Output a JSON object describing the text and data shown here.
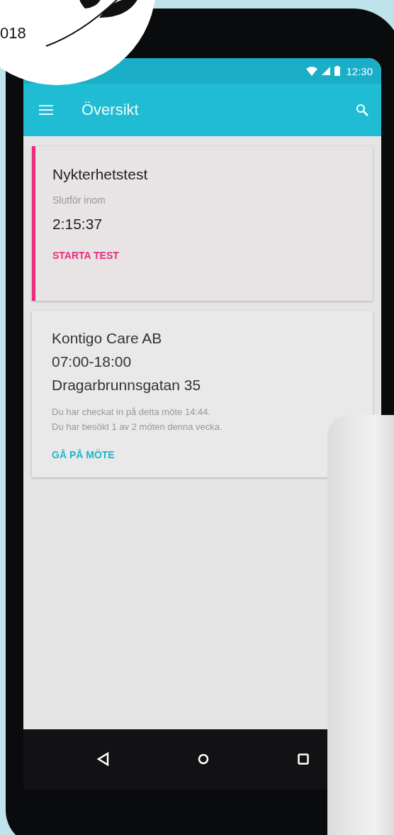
{
  "badge": {
    "text": "018"
  },
  "status_bar": {
    "time": "12:30"
  },
  "app_bar": {
    "title": "Översikt"
  },
  "cards": [
    {
      "kind": "test",
      "title": "Nykterhetstest",
      "subtitle": "Slutför inom",
      "timer": "2:15:37",
      "action": "STARTA TEST"
    },
    {
      "kind": "meeting",
      "lines": [
        "Kontigo Care AB",
        "07:00-18:00",
        "Dragarbrunnsgatan 35"
      ],
      "notes": [
        "Du har checkat in på detta möte 14:44.",
        "Du har besökt 1 av 2 möten denna vecka."
      ],
      "action": "GÅ PÅ MÖTE"
    }
  ]
}
